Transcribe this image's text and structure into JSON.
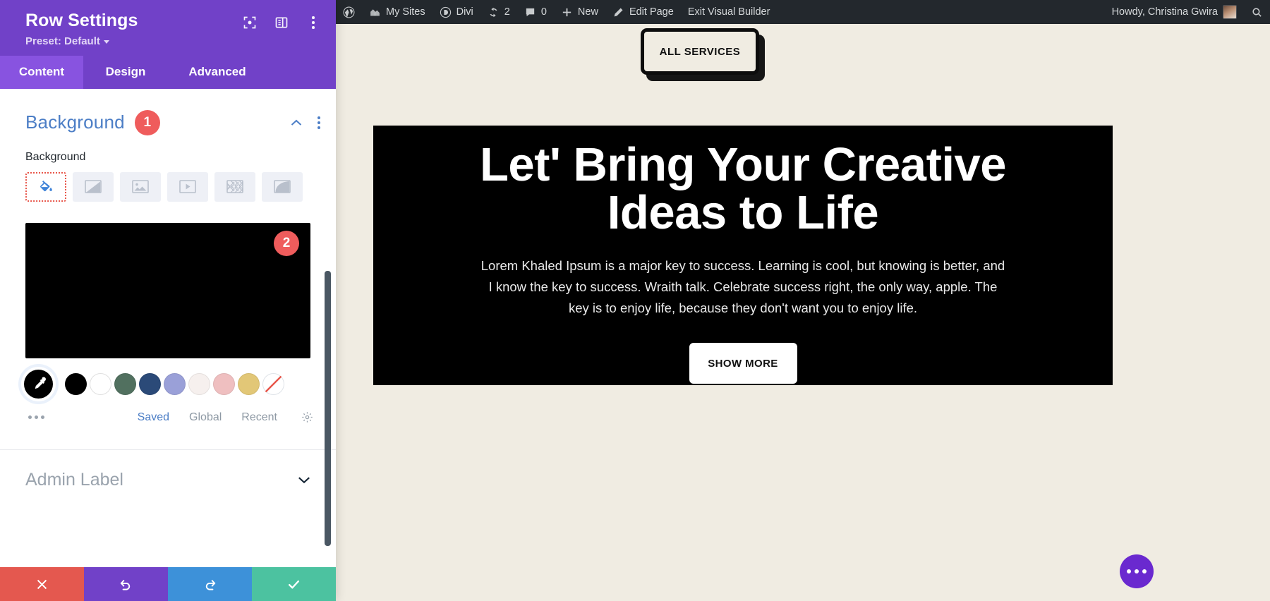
{
  "settings_panel": {
    "title": "Row Settings",
    "preset_label": "Preset: Default",
    "header_icons": [
      {
        "name": "focus-frame-icon"
      },
      {
        "name": "layout-panel-icon"
      },
      {
        "name": "kebab-menu-icon"
      }
    ],
    "tabs": [
      {
        "label": "Content",
        "active": true
      },
      {
        "label": "Design",
        "active": false
      },
      {
        "label": "Advanced",
        "active": false
      }
    ],
    "background_section": {
      "title": "Background",
      "badge": "1",
      "field_label": "Background",
      "types": [
        {
          "name": "background-color-tab",
          "icon": "paint-bucket-icon",
          "active": true
        },
        {
          "name": "background-gradient-tab",
          "icon": "gradient-icon",
          "active": false
        },
        {
          "name": "background-image-tab",
          "icon": "image-icon",
          "active": false
        },
        {
          "name": "background-video-tab",
          "icon": "video-icon",
          "active": false
        },
        {
          "name": "background-pattern-tab",
          "icon": "pattern-icon",
          "active": false
        },
        {
          "name": "background-mask-tab",
          "icon": "mask-icon",
          "active": false
        }
      ],
      "selected_color": "#000000",
      "preview_badge": "2",
      "swatches": [
        "#000000",
        "#ffffff",
        "#51705f",
        "#2b4a78",
        "#9aa0d8",
        "#f6f0ee",
        "#efbfc0",
        "#e2c777",
        "transparent"
      ],
      "swatch_names": [
        "swatch-black",
        "swatch-white",
        "swatch-green",
        "swatch-navy",
        "swatch-periwinkle",
        "swatch-offwhite",
        "swatch-pink",
        "swatch-gold",
        "swatch-none"
      ],
      "palette_tabs": [
        {
          "label": "Saved",
          "active": true
        },
        {
          "label": "Global",
          "active": false
        },
        {
          "label": "Recent",
          "active": false
        }
      ],
      "gear_icon": "gear-icon"
    },
    "admin_label": {
      "title": "Admin Label"
    },
    "bottom_bar": [
      {
        "name": "cancel-button",
        "icon": "close-icon",
        "color": "#e4584f"
      },
      {
        "name": "undo-button",
        "icon": "undo-icon",
        "color": "#7141c8"
      },
      {
        "name": "redo-button",
        "icon": "redo-icon",
        "color": "#3d91d9"
      },
      {
        "name": "save-button",
        "icon": "check-icon",
        "color": "#4cc2a0"
      }
    ]
  },
  "adminbar": {
    "wp_logo": "wordpress-icon",
    "items": [
      {
        "label": "My Sites",
        "icon": "sites-icon"
      },
      {
        "label": "Divi",
        "icon": "divi-icon"
      },
      {
        "label": "2",
        "icon": "updates-icon"
      },
      {
        "label": "0",
        "icon": "comments-icon"
      },
      {
        "label": "New",
        "icon": "plus-icon"
      },
      {
        "label": "Edit Page",
        "icon": "pencil-icon"
      },
      {
        "label": "Exit Visual Builder",
        "icon": null
      }
    ],
    "howdy": "Howdy, Christina Gwira",
    "search_icon": "search-icon"
  },
  "page": {
    "all_services_button": "ALL SERVICES",
    "hero_title": "Let' Bring Your Creative Ideas to Life",
    "hero_paragraph": "Lorem Khaled Ipsum is a major key to success. Learning is cool, but knowing is better, and I know the key to success. Wraith talk. Celebrate success right, the only way, apple. The key is to enjoy life, because they don't want you to enjoy life.",
    "show_more_button": "SHOW MORE",
    "fab": "more-options-button",
    "colors": {
      "page_bg": "#f0ece2",
      "hero_bg": "#000000",
      "accent_purple": "#6a29cf"
    }
  }
}
